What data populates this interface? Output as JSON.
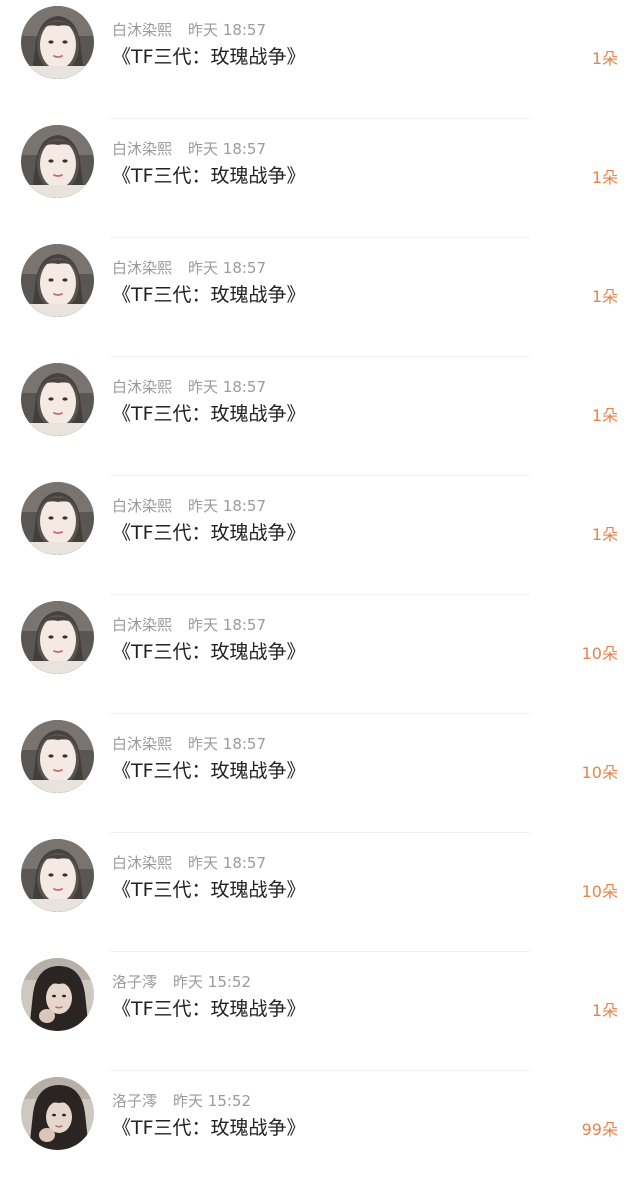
{
  "colors": {
    "username": "#9b9b9b",
    "title": "#222222",
    "count": "#e8834b",
    "divider": "#f1f1f1"
  },
  "items": [
    {
      "user": "白沐染熙",
      "time": "昨天 18:57",
      "title": "《TF三代：玫瑰战争》",
      "count": "1朵",
      "avatar": "avatar-light-girl-icon"
    },
    {
      "user": "白沐染熙",
      "time": "昨天 18:57",
      "title": "《TF三代：玫瑰战争》",
      "count": "1朵",
      "avatar": "avatar-light-girl-icon"
    },
    {
      "user": "白沐染熙",
      "time": "昨天 18:57",
      "title": "《TF三代：玫瑰战争》",
      "count": "1朵",
      "avatar": "avatar-light-girl-icon"
    },
    {
      "user": "白沐染熙",
      "time": "昨天 18:57",
      "title": "《TF三代：玫瑰战争》",
      "count": "1朵",
      "avatar": "avatar-light-girl-icon"
    },
    {
      "user": "白沐染熙",
      "time": "昨天 18:57",
      "title": "《TF三代：玫瑰战争》",
      "count": "1朵",
      "avatar": "avatar-light-girl-icon"
    },
    {
      "user": "白沐染熙",
      "time": "昨天 18:57",
      "title": "《TF三代：玫瑰战争》",
      "count": "10朵",
      "avatar": "avatar-light-girl-icon"
    },
    {
      "user": "白沐染熙",
      "time": "昨天 18:57",
      "title": "《TF三代：玫瑰战争》",
      "count": "10朵",
      "avatar": "avatar-light-girl-icon"
    },
    {
      "user": "白沐染熙",
      "time": "昨天 18:57",
      "title": "《TF三代：玫瑰战争》",
      "count": "10朵",
      "avatar": "avatar-light-girl-icon"
    },
    {
      "user": "洛子澪",
      "time": "昨天 15:52",
      "title": "《TF三代：玫瑰战争》",
      "count": "1朵",
      "avatar": "avatar-dark-girl-icon"
    },
    {
      "user": "洛子澪",
      "time": "昨天 15:52",
      "title": "《TF三代：玫瑰战争》",
      "count": "99朵",
      "avatar": "avatar-dark-girl-icon"
    }
  ]
}
